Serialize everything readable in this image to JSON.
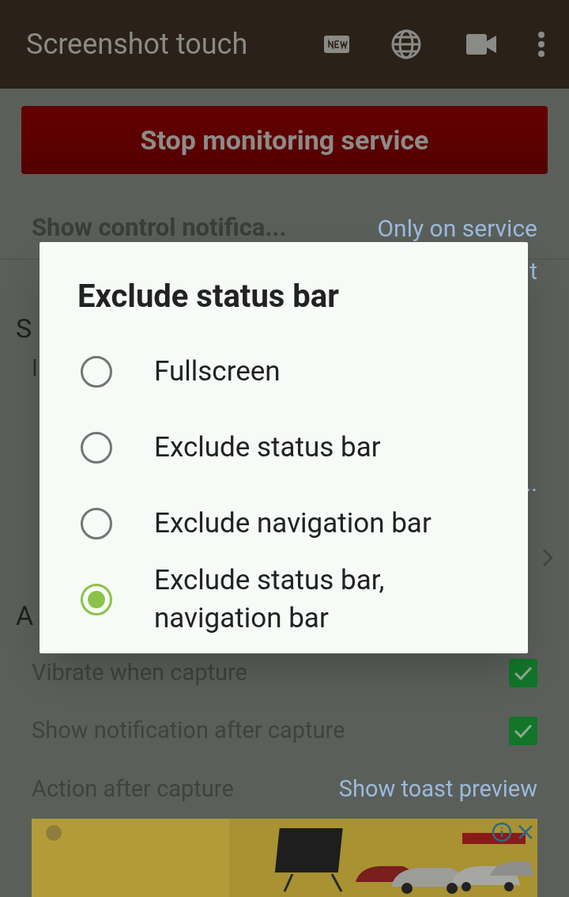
{
  "app_bar": {
    "title": "Screenshot touch"
  },
  "stop_button": {
    "label": "Stop monitoring service"
  },
  "settings": [
    {
      "kind": "bold_value",
      "label": "Show control notifica...",
      "value": "Only on service"
    },
    {
      "kind": "partial",
      "value": "t"
    },
    {
      "kind": "header",
      "label": "S"
    },
    {
      "kind": "partial",
      "label": "I"
    },
    {
      "kind": "blank"
    },
    {
      "kind": "partial",
      "value": ".."
    },
    {
      "kind": "chevron"
    },
    {
      "kind": "header",
      "label": "A"
    },
    {
      "kind": "checkbox",
      "label": "Vibrate when capture",
      "checked": true
    },
    {
      "kind": "checkbox",
      "label": "Show notification after capture",
      "checked": true
    },
    {
      "kind": "value",
      "label": "Action after capture",
      "value": "Show toast preview"
    }
  ],
  "dialog": {
    "title": "Exclude status bar",
    "options": [
      {
        "label": "Fullscreen",
        "selected": false
      },
      {
        "label": "Exclude status bar",
        "selected": false
      },
      {
        "label": "Exclude navigation bar",
        "selected": false
      },
      {
        "label": "Exclude status bar, navigation bar",
        "selected": true
      }
    ]
  }
}
